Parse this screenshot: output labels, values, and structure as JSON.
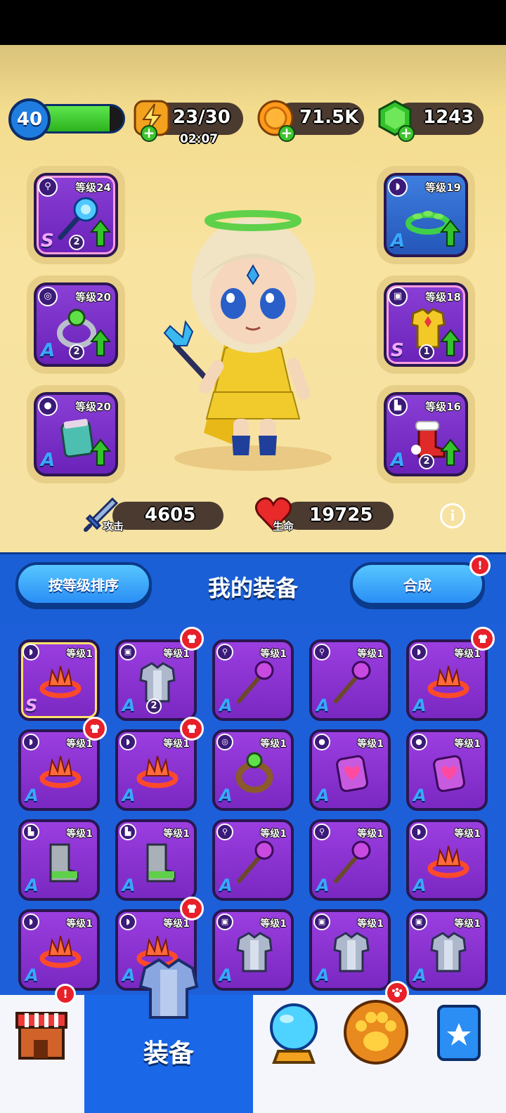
{
  "header": {
    "player_level": "40",
    "xp_progress": 0.85,
    "energy": "23/30",
    "energy_timer": "02:07",
    "gold": "71.5K",
    "gems": "1243"
  },
  "equipped": {
    "left": [
      {
        "level": "等级24",
        "grade": "S",
        "stars": "2",
        "type": "staff",
        "rainbow": true
      },
      {
        "level": "等级20",
        "grade": "A",
        "stars": "2",
        "type": "ring",
        "rainbow": false
      },
      {
        "level": "等级20",
        "grade": "A",
        "stars": "",
        "type": "bracer",
        "rainbow": false
      }
    ],
    "right": [
      {
        "level": "等级19",
        "grade": "A",
        "stars": "",
        "type": "helmet",
        "rainbow": false
      },
      {
        "level": "等级18",
        "grade": "S",
        "stars": "1",
        "type": "armor",
        "rainbow": true
      },
      {
        "level": "等级16",
        "grade": "A",
        "stars": "2",
        "type": "boots",
        "rainbow": false
      }
    ]
  },
  "stats": {
    "attack_label": "攻击",
    "attack_value": "4605",
    "hp_label": "生命",
    "hp_value": "19725",
    "info_icon": "i"
  },
  "panel": {
    "sort_button": "按等级排序",
    "title": "我的装备",
    "merge_button": "合成",
    "alert": "!"
  },
  "inventory": [
    {
      "level": "等级1",
      "grade": "S",
      "stars": "",
      "type": "helmet",
      "new": false
    },
    {
      "level": "等级1",
      "grade": "A",
      "stars": "2",
      "type": "armor",
      "new": true
    },
    {
      "level": "等级1",
      "grade": "A",
      "stars": "",
      "type": "staff",
      "new": false
    },
    {
      "level": "等级1",
      "grade": "A",
      "stars": "",
      "type": "staff",
      "new": false
    },
    {
      "level": "等级1",
      "grade": "A",
      "stars": "",
      "type": "helmet",
      "new": true
    },
    {
      "level": "等级1",
      "grade": "A",
      "stars": "",
      "type": "helmet",
      "new": true
    },
    {
      "level": "等级1",
      "grade": "A",
      "stars": "",
      "type": "helmet",
      "new": true
    },
    {
      "level": "等级1",
      "grade": "A",
      "stars": "",
      "type": "ring",
      "new": false
    },
    {
      "level": "等级1",
      "grade": "A",
      "stars": "",
      "type": "bracer",
      "new": false
    },
    {
      "level": "等级1",
      "grade": "A",
      "stars": "",
      "type": "bracer",
      "new": false
    },
    {
      "level": "等级1",
      "grade": "A",
      "stars": "",
      "type": "boots",
      "new": false
    },
    {
      "level": "等级1",
      "grade": "A",
      "stars": "",
      "type": "boots",
      "new": false
    },
    {
      "level": "等级1",
      "grade": "A",
      "stars": "",
      "type": "staff",
      "new": false
    },
    {
      "level": "等级1",
      "grade": "A",
      "stars": "",
      "type": "staff",
      "new": false
    },
    {
      "level": "等级1",
      "grade": "A",
      "stars": "",
      "type": "helmet",
      "new": false
    },
    {
      "level": "等级1",
      "grade": "A",
      "stars": "",
      "type": "helmet",
      "new": false
    },
    {
      "level": "等级1",
      "grade": "A",
      "stars": "",
      "type": "helmet",
      "new": true
    },
    {
      "level": "等级1",
      "grade": "A",
      "stars": "",
      "type": "armor",
      "new": false
    },
    {
      "level": "等级1",
      "grade": "A",
      "stars": "",
      "type": "armor",
      "new": false
    },
    {
      "level": "等级1",
      "grade": "A",
      "stars": "",
      "type": "armor",
      "new": false
    }
  ],
  "nav": {
    "active_label": "装备",
    "alert": "!"
  }
}
